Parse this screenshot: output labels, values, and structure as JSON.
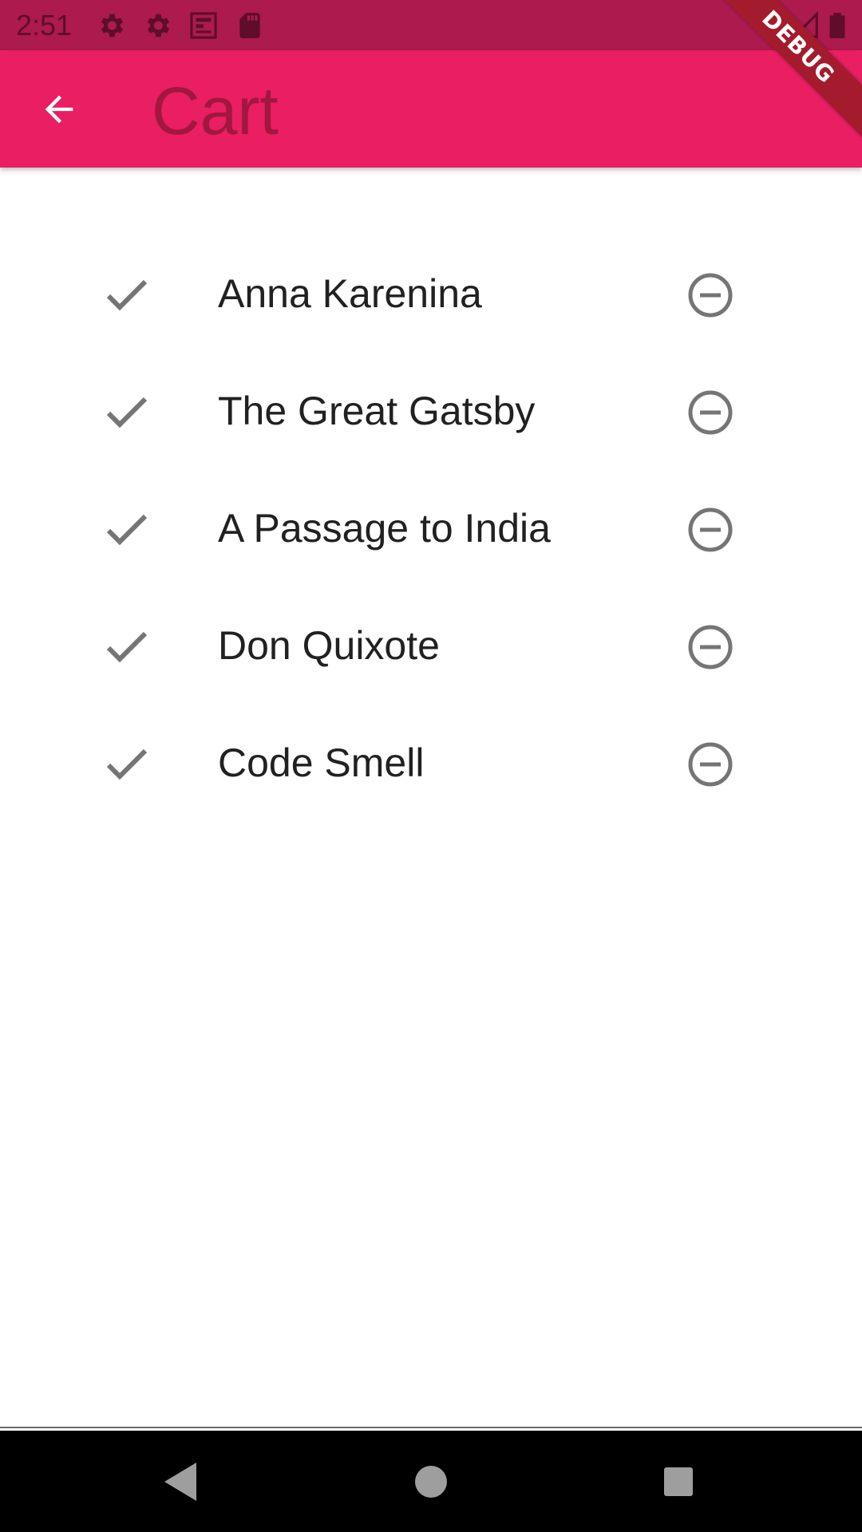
{
  "status_bar": {
    "time": "2:51",
    "background": "#ad1a4d",
    "icons": [
      "settings-icon",
      "settings-icon",
      "news-icon",
      "sd-card-icon",
      "wifi-icon",
      "signal-icon",
      "battery-icon"
    ]
  },
  "app_bar": {
    "title": "Cart",
    "background": "#e91e63",
    "back_icon": "arrow-back-icon"
  },
  "debug_banner": {
    "label": "DEBUG"
  },
  "cart": {
    "items": [
      {
        "title": "Anna Karenina",
        "status_icon": "check-icon",
        "action_icon": "remove-circle-icon"
      },
      {
        "title": "The Great Gatsby",
        "status_icon": "check-icon",
        "action_icon": "remove-circle-icon"
      },
      {
        "title": "A Passage to India",
        "status_icon": "check-icon",
        "action_icon": "remove-circle-icon"
      },
      {
        "title": "Don Quixote",
        "status_icon": "check-icon",
        "action_icon": "remove-circle-icon"
      },
      {
        "title": "Code Smell",
        "status_icon": "check-icon",
        "action_icon": "remove-circle-icon"
      }
    ]
  },
  "nav_bar": {
    "buttons": [
      "back-triangle-icon",
      "home-circle-icon",
      "recents-square-icon"
    ]
  }
}
